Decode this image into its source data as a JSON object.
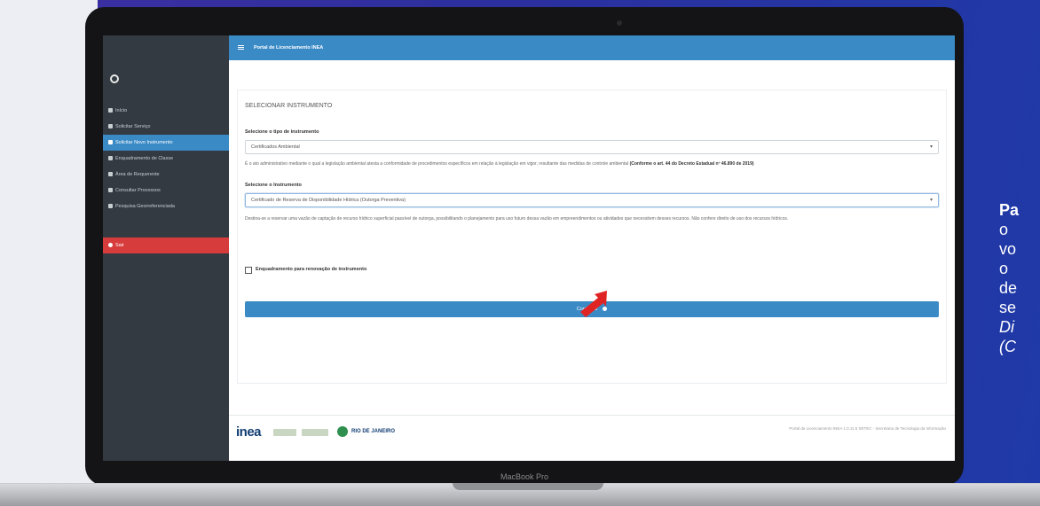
{
  "page": {
    "device_label": "MacBook Pro"
  },
  "app": {
    "topbar_title": "Portal de Licenciamento INEA",
    "sidebar_items": [
      {
        "label": "Início",
        "state": "normal"
      },
      {
        "label": "Solicitar Serviço",
        "state": "normal"
      },
      {
        "label": "Solicitar Novo Instrumento",
        "state": "active"
      },
      {
        "label": "Enquadramento de Classe",
        "state": "normal"
      },
      {
        "label": "Área de Requerente",
        "state": "normal"
      },
      {
        "label": "Consultar Processos",
        "state": "normal"
      },
      {
        "label": "Pesquisa Georreferenciada",
        "state": "normal"
      },
      {
        "label": "Sair",
        "state": "exit"
      }
    ],
    "card_title": "SELECIONAR INSTRUMENTO",
    "type_label": "Selecione o tipo de instrumento",
    "type_value": "Certificados Ambiental",
    "type_info_text": "É o ato administrativo mediante o qual a legislação ambiental atesta a conformidade de procedimentos específicos em relação à legislação em vigor, resultante das medidas de controle ambiental",
    "type_info_bold": "(Conforme o art. 44 do Decreto Estadual nº 46.890 de 2019)",
    "instrument_label": "Selecione o Instrumento",
    "instrument_value": "Certificado de Reserva de Disponibilidade Hídrica (Outorga Preventiva)",
    "instrument_info": "Destina-se a reservar uma vazão de captação de recurso hídrico superficial passível de outorga, possibilitando o planejamento para uso futuro dessa vazão em empreendimentos ou atividades que necessitem desses recursos. Não confere direito de uso dos recursos hídricos.",
    "checkbox_label": "Enquadramento para renovação de instrumento",
    "checkbox_checked": false,
    "continue_label": "Continuar",
    "footer_logo": "inea",
    "footer_rj": "RIO DE JANEIRO",
    "footer_text": "Portal de Licenciamento INEA 1.0.11.5 SETEC - Secretaria de Tecnologia da Informação"
  },
  "side_text": {
    "lines": [
      {
        "text": "Pa",
        "style": "bold"
      },
      {
        "text": "o",
        "style": "normal"
      },
      {
        "text": "vo",
        "style": "normal"
      },
      {
        "text": "o",
        "style": "normal"
      },
      {
        "text": "de",
        "style": "normal"
      },
      {
        "text": "se",
        "style": "normal"
      },
      {
        "text": "Di",
        "style": "italic"
      },
      {
        "text": "(C",
        "style": "italic"
      }
    ]
  },
  "colors": {
    "accent": "#3a8ac6",
    "sidebar": "#333a41",
    "exit": "#d73c3c",
    "background_blue": "#2c2f9e"
  }
}
